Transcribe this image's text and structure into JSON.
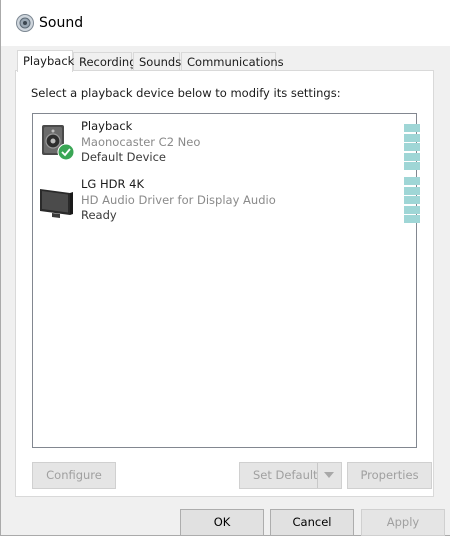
{
  "window": {
    "title": "Sound"
  },
  "tabs": [
    {
      "label": "Playback",
      "active": true
    },
    {
      "label": "Recording",
      "active": false
    },
    {
      "label": "Sounds",
      "active": false
    },
    {
      "label": "Communications",
      "active": false
    }
  ],
  "panel": {
    "instructions": "Select a playback device below to modify its settings:",
    "devices": [
      {
        "name": "Playback",
        "description": "Maonocaster C2 Neo",
        "status": "Default Device",
        "icon": "speaker-icon",
        "default_badge": "check-badge-icon"
      },
      {
        "name": "LG HDR 4K",
        "description": "HD Audio Driver for Display Audio",
        "status": "Ready",
        "icon": "monitor-icon"
      }
    ],
    "buttons": {
      "configure": "Configure",
      "set_default": "Set Default",
      "properties": "Properties"
    }
  },
  "footer": {
    "ok": "OK",
    "cancel": "Cancel",
    "apply": "Apply"
  },
  "colors": {
    "meter": "#9fd6d6",
    "badge": "#3aa655",
    "disabled_text": "#a0a0a0"
  }
}
